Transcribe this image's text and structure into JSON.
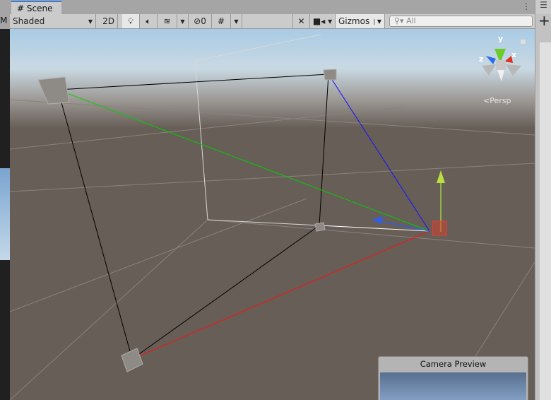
{
  "left_panel": {
    "tab_fragment": "M"
  },
  "tab": {
    "icon": "hash-icon",
    "label": "Scene"
  },
  "toolbar": {
    "shading_mode": "Shaded",
    "mode_2d": "2D",
    "hidden_count": "0",
    "gizmos_label": "Gizmos",
    "search_placeholder": "All"
  },
  "viewport": {
    "projection_label": "Persp",
    "gizmo_axes": {
      "x": "x",
      "y": "y",
      "z": "z"
    },
    "colors": {
      "x_axis": "#e0301e",
      "y_axis": "#7fcf2a",
      "z_axis": "#3a6fe0",
      "ground": "#675e57"
    }
  },
  "camera_preview": {
    "title": "Camera Preview"
  }
}
